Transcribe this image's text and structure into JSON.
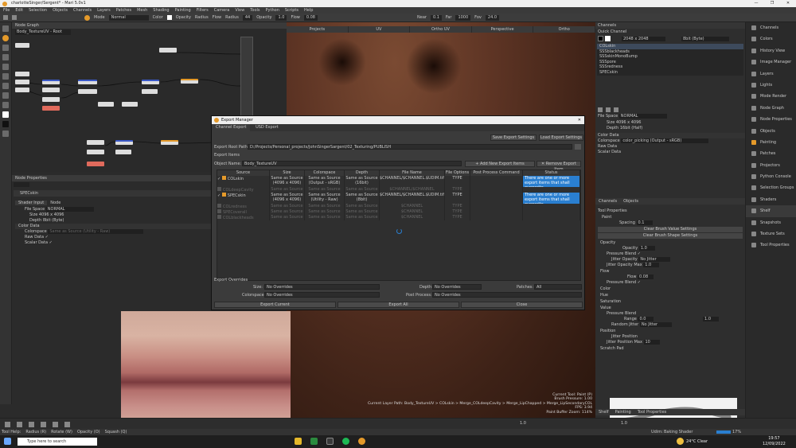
{
  "window": {
    "title": "charlotteSinger/Sergent* - Mari 5.0v1",
    "buttons": [
      "—",
      "❐",
      "✕"
    ]
  },
  "menu": [
    "File",
    "Edit",
    "Selection",
    "Objects",
    "Channels",
    "Layers",
    "Patches",
    "Mesh",
    "Shading",
    "Painting",
    "Filters",
    "Camera",
    "View",
    "Tools",
    "Python",
    "Scripts",
    "Help"
  ],
  "toolbar": {
    "mode_label": "Mode",
    "mode_value": "Normal",
    "color_label": "Color",
    "opacity_label": "Opacity",
    "radius_label": "Radius",
    "flow_label": "Flow",
    "radius_value": "44",
    "opacity_value": "1.0",
    "flow_value": "0.08",
    "near_label": "Near",
    "near_value": "0.1",
    "far_label": "Far",
    "far_value": "1000",
    "fov_label": "Fov",
    "fov_value": "24.0"
  },
  "node_graph": {
    "title": "Node Graph",
    "breadcrumb": "Body_TextureUV - Root"
  },
  "node_properties": {
    "title": "Node Properties",
    "node_name": "SPECskin",
    "tabs": [
      "Shader Input",
      "Node"
    ],
    "file_space_label": "File Space",
    "file_space_value": "NORMAL",
    "size_label": "Size",
    "size_value": "4096 x 4096",
    "depth_label": "Depth",
    "depth_value": "8bit (Byte)",
    "color_data_header": "Color Data",
    "colorspace_label": "Colorspace",
    "colorspace_value": "Same as Source (Utility - Raw)",
    "raw_data_label": "Raw Data",
    "scalar_data_label": "Scalar Data"
  },
  "viewport": {
    "tabs": [
      "Projects",
      "UV",
      "Ortho UV",
      "Perspective",
      "Ortho"
    ],
    "info_lines": [
      "Current Tool: Paint (P)",
      "Brush Pressure: 1.00",
      "Current Layer Path: Body_TextureUV > COLskin > Merge_COLdeepCavity > Merge_LipChapped > Merge_LipSecondaryCOL",
      "FPS: 3.94",
      "Paint Buffer Zoom: 114%"
    ]
  },
  "export_manager": {
    "title": "Export Manager",
    "tabs": [
      "Channel Export",
      "USD Export"
    ],
    "save_settings": "Save Export Settings",
    "load_settings": "Load Export Settings",
    "root_path_label": "Export Root Path:",
    "root_path_value": "D:/Projects/Personal_projects/JohnSingerSargent/02_Texturing/PUBLISH",
    "items_label": "Export Items",
    "object_name_label": "Object Name:",
    "object_name_value": "Body_TextureUV",
    "add_item": "+ Add New Export Items",
    "remove_item": "✕ Remove Export Item",
    "columns": [
      "Source",
      "Size",
      "Colorspace",
      "Depth",
      "File Name",
      "File Options",
      "Post Process Command",
      "Status"
    ],
    "rows": [
      {
        "checked": true,
        "source": "COLskin",
        "size": "Same as Source (4096 x 4096)",
        "colorspace": "Same as Source (Output - sRGB)",
        "depth": "Same as Source (16bit)",
        "filename": "$CHANNEL/$CHANNEL.$UDIM.tif",
        "options": "TYPE",
        "status": "There are one or more export items that shall overwrite.",
        "active": true
      },
      {
        "checked": false,
        "source": "COLdeepCavity",
        "size": "Same as Source",
        "colorspace": "Same as Source",
        "depth": "Same as Source",
        "filename": "$CHANNEL/$CHANNEL",
        "options": "TYPE",
        "status": "",
        "active": false
      },
      {
        "checked": true,
        "source": "SPECskin",
        "size": "Same as Source (4096 x 4096)",
        "colorspace": "Same as Source (Utility - Raw)",
        "depth": "Same as Source (8bit)",
        "filename": "$CHANNEL/$CHANNEL.$UDIM.tif",
        "options": "TYPE",
        "status": "There are one or more export items that shall overwrite.",
        "active": true
      },
      {
        "checked": false,
        "source": "COLredness",
        "size": "Same as Source",
        "colorspace": "Same as Source",
        "depth": "Same as Source",
        "filename": "$CHANNEL",
        "options": "TYPE",
        "status": "",
        "active": false
      },
      {
        "checked": false,
        "source": "SPECoverall",
        "size": "Same as Source",
        "colorspace": "Same as Source",
        "depth": "Same as Source",
        "filename": "$CHANNEL",
        "options": "TYPE",
        "status": "",
        "active": false
      },
      {
        "checked": false,
        "source": "COLblackheads",
        "size": "Same as Source",
        "colorspace": "Same as Source",
        "depth": "Same as Source",
        "filename": "$CHANNEL",
        "options": "TYPE",
        "status": "",
        "active": false
      }
    ],
    "overrides_label": "Export Overrides",
    "size_label": "Size:",
    "size_value": "No Overrides",
    "depth_label": "Depth:",
    "depth_value": "No Overrides",
    "patches_label": "Patches:",
    "patches_value": "All",
    "colorspace_label": "Colorspace:",
    "colorspace_value": "No Overrides",
    "postprocess_label": "Post Process:",
    "postprocess_value": "No Overrides",
    "export_current": "Export Current",
    "export_all": "Export All",
    "close": "Close"
  },
  "channels_panel": {
    "header": "Channels",
    "quick_channel": "Quick Channel",
    "size_value": "2048 x 2048",
    "depth_value": "8bit (Byte)",
    "channels": [
      "COLskin",
      "SSSblackheads",
      "SSSskinMonoBump",
      "SSSpore",
      "SSSredness",
      "SPECskin"
    ],
    "file_space_label": "File Space",
    "file_space_value": "NORMAL",
    "size_label": "Size",
    "size_value2": "4096 x 4096",
    "depth_label": "Depth",
    "depth_value2": "16bit (Half)",
    "color_data": "Color Data",
    "colorspace_label": "Colorspace",
    "colorspace_value": "color_picking (Output - sRGB)",
    "raw_data": "Raw Data",
    "scalar_data": "Scalar Data",
    "tabs": [
      "Channels",
      "Objects"
    ]
  },
  "tool_properties": {
    "header": "Tool Properties",
    "paint": "Paint",
    "spacing_label": "Spacing",
    "spacing_value": "0.1",
    "clear_brush_value": "Clear Brush Value Settings",
    "clear_brush_shape": "Clear Brush Shape Settings",
    "opacity_section": "Opacity",
    "opacity_label": "Opacity",
    "opacity_value": "1.0",
    "pressure_blend": "Pressure Blend",
    "jitter_opacity": "Jitter Opacity",
    "jitter_opacity_value": "No Jitter",
    "jitter_opacity_max": "Jitter Opacity Max",
    "jitter_opacity_max_value": "1.0",
    "flow_section": "Flow",
    "flow_label": "Flow",
    "flow_value": "0.08",
    "pressure_blend2": "Pressure Blend",
    "sections": [
      "Color",
      "Hue",
      "Saturation"
    ],
    "value_section": "Value",
    "pressure_blend3": "Pressure Blend",
    "range_label": "Range",
    "range_min": "0.0",
    "range_max": "1.0",
    "random_jitter": "Random Jitter",
    "random_jitter_value": "No Jitter",
    "position_section": "Position",
    "jitter_position": "Jitter Position",
    "jitter_position_max": "Jitter Position Max",
    "jitter_position_max_value": "10",
    "scratch_pad": "Scratch Pad",
    "bottom_tabs": [
      "Shelf",
      "Painting",
      "Tool Properties"
    ]
  },
  "right_nav": [
    "Channels",
    "Colors",
    "History View",
    "Image Manager",
    "Layers",
    "Lights",
    "Mode Render",
    "Node Graph",
    "Node Properties",
    "Objects",
    "Painting",
    "Patches",
    "Projectors",
    "Python Console",
    "Selection Groups",
    "Shaders",
    "Shelf",
    "Snapshots",
    "Texture Sets",
    "Tool Properties"
  ],
  "status": {
    "tool_help": "Tool Help:",
    "hints": [
      "Radius (R)",
      "Rotate (W)",
      "Opacity (O)",
      "Squash (Q)"
    ],
    "udim_label": "Udim:",
    "baking_shader": "Baking Shader",
    "zoom": "17%",
    "value_a": "1.0",
    "value_b": "1.0"
  },
  "taskbar": {
    "search_placeholder": "Type here to search",
    "weather": "24°C Clear",
    "time": "19:57",
    "date": "12/09/2022"
  },
  "colors": {
    "accent_orange": "#e59a2a",
    "status_blue": "#2a7fd0",
    "node_blue": "#3b59c7",
    "node_red": "#e06a5c"
  }
}
